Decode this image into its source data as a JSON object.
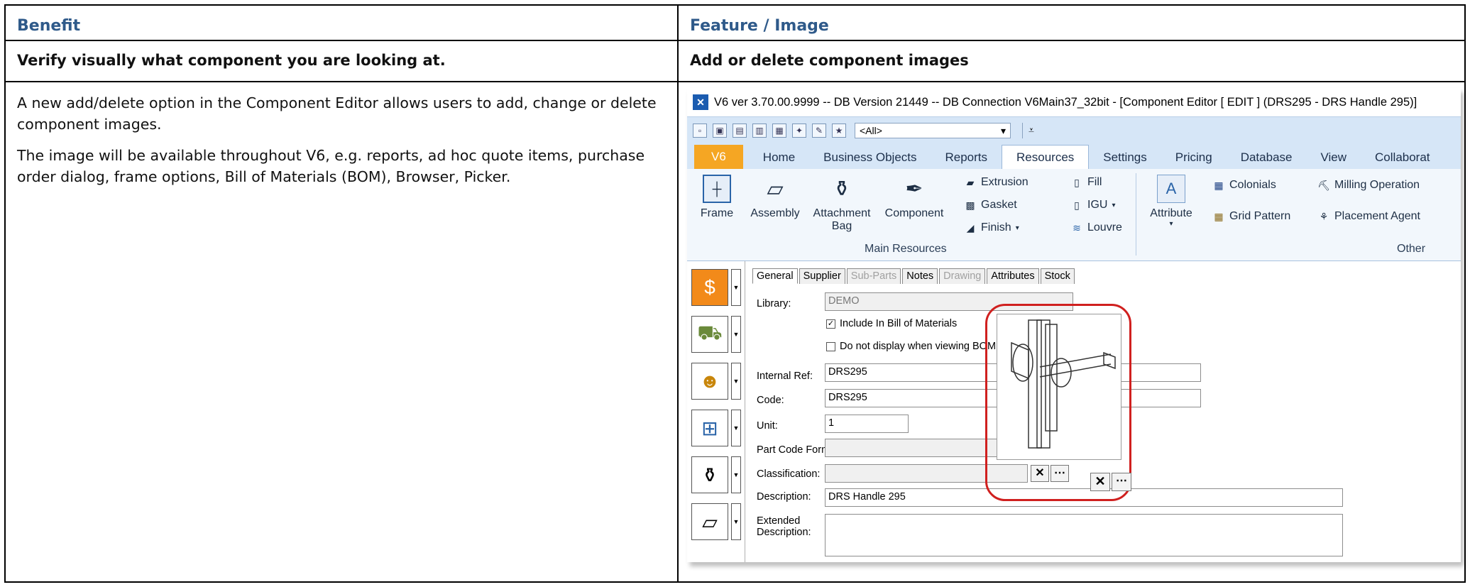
{
  "table": {
    "header_left": "Benefit",
    "header_right": "Feature / Image",
    "sub_left": "Verify visually what component you are looking at.",
    "sub_right": "Add or delete component images",
    "paragraphs": [
      "A new add/delete option in the Component Editor allows users to add, change or delete component images.",
      "The image will be available throughout V6, e.g. reports, ad hoc quote items, purchase order dialog, frame options, Bill of Materials (BOM), Browser, Picker."
    ]
  },
  "app": {
    "title": "V6 ver 3.70.00.9999 -- DB Version 21449 -- DB Connection V6Main37_32bit - [Component Editor  [ EDIT ] (DRS295 - DRS Handle 295)]",
    "qat_combo": "<All>",
    "tabs": [
      "V6",
      "Home",
      "Business Objects",
      "Reports",
      "Resources",
      "Settings",
      "Pricing",
      "Database",
      "View",
      "Collaborat"
    ],
    "active_tab": "Resources",
    "ribbon": {
      "main": [
        {
          "label": "Frame",
          "icon": "frame-icon"
        },
        {
          "label": "Assembly",
          "icon": "assembly-icon"
        },
        {
          "label": "Attachment Bag",
          "icon": "attachment-bag-icon"
        },
        {
          "label": "Component",
          "icon": "component-icon"
        }
      ],
      "small_col1": [
        "Extrusion",
        "Gasket",
        "Finish"
      ],
      "small_col2": [
        "Fill",
        "IGU",
        "Louvre"
      ],
      "attribute": "Attribute",
      "other_col1": [
        "Colonials",
        "Grid Pattern"
      ],
      "other_col2": [
        "Milling Operation",
        "Placement Agent"
      ],
      "group_main": "Main Resources",
      "group_other": "Other"
    },
    "editor_tabs": [
      {
        "label": "General",
        "state": "active"
      },
      {
        "label": "Supplier",
        "state": "normal"
      },
      {
        "label": "Sub-Parts",
        "state": "disabled"
      },
      {
        "label": "Notes",
        "state": "normal"
      },
      {
        "label": "Drawing",
        "state": "disabled"
      },
      {
        "label": "Attributes",
        "state": "normal"
      },
      {
        "label": "Stock",
        "state": "normal"
      }
    ],
    "form": {
      "library_label": "Library:",
      "library_value": "DEMO",
      "include_bom": "Include In Bill of Materials",
      "no_display_bom": "Do not display when viewing BOM",
      "internal_ref_label": "Internal Ref:",
      "internal_ref_value": "DRS295",
      "code_label": "Code:",
      "code_value": "DRS295",
      "unit_label": "Unit:",
      "unit_value": "1",
      "part_code_label": "Part Code Formula:",
      "classification_label": "Classification:",
      "description_label": "Description:",
      "description_value": "DRS Handle 295",
      "ext_desc_label": "Extended Description:"
    },
    "colors": {
      "accent": "#2f5a8a",
      "highlight": "#d0201f",
      "ribbon_bg": "#d6e6f7",
      "file_tab": "#f5a623"
    }
  }
}
